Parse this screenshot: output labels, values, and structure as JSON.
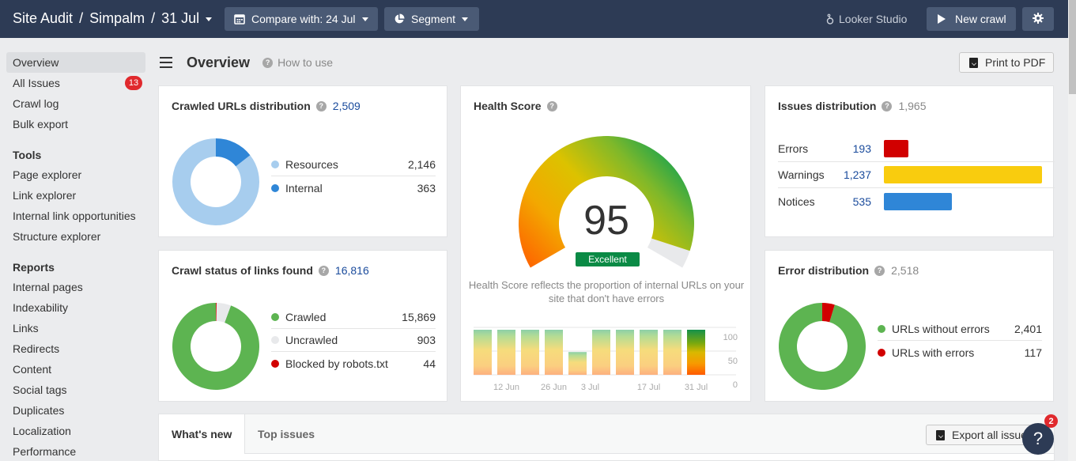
{
  "topbar": {
    "breadcrumb": [
      "Site Audit",
      "Simpalm",
      "31 Jul"
    ],
    "separator": "/",
    "compare_label": "Compare with: 24 Jul",
    "segment_label": "Segment",
    "looker_label": "Looker Studio",
    "new_crawl_label": "New crawl",
    "icons": {
      "compare": "calendar-icon",
      "segment": "pie-chart-icon",
      "looker": "looker-icon",
      "new_crawl": "play-icon",
      "settings": "gear-icon"
    }
  },
  "sidebar": {
    "items": [
      {
        "label": "Overview",
        "active": true
      },
      {
        "label": "All Issues",
        "badge": "13"
      },
      {
        "label": "Crawl log"
      },
      {
        "label": "Bulk export"
      }
    ],
    "tools_heading": "Tools",
    "tools": [
      "Page explorer",
      "Link explorer",
      "Internal link opportunities",
      "Structure explorer"
    ],
    "reports_heading": "Reports",
    "reports": [
      "Internal pages",
      "Indexability",
      "Links",
      "Redirects",
      "Content",
      "Social tags",
      "Duplicates",
      "Localization",
      "Performance"
    ]
  },
  "page": {
    "title": "Overview",
    "how_to_use": "How to use",
    "print_label": "Print to PDF",
    "help_icon": "?",
    "info_icon": "?"
  },
  "crawled_urls": {
    "title": "Crawled URLs distribution",
    "total": "2,509",
    "items": [
      {
        "label": "Resources",
        "value": "2,146",
        "raw": 2146,
        "color": "#a7cdee"
      },
      {
        "label": "Internal",
        "value": "363",
        "raw": 363,
        "color": "#2f86d7"
      }
    ]
  },
  "crawl_status": {
    "title": "Crawl status of links found",
    "total": "16,816",
    "items": [
      {
        "label": "Crawled",
        "value": "15,869",
        "raw": 15869,
        "color": "#5db451"
      },
      {
        "label": "Uncrawled",
        "value": "903",
        "raw": 903,
        "color": "#e8e9eb"
      },
      {
        "label": "Blocked by robots.txt",
        "value": "44",
        "raw": 44,
        "color": "#d10000"
      }
    ]
  },
  "health": {
    "title": "Health Score",
    "score": "95",
    "score_value": 95,
    "rating": "Excellent",
    "description": "Health Score reflects the proportion of internal URLs on your site that don't have errors",
    "history": {
      "y_ticks": [
        "100",
        "50",
        "0"
      ],
      "x_labels": [
        "12 Jun",
        "26 Jun",
        "3 Jul",
        "17 Jul",
        "31 Jul"
      ],
      "values": [
        95,
        95,
        95,
        95,
        48,
        95,
        95,
        95,
        95,
        95
      ]
    }
  },
  "issues": {
    "title": "Issues distribution",
    "total": "1,965",
    "items": [
      {
        "label": "Errors",
        "value": "193",
        "raw": 193,
        "color": "#d10000"
      },
      {
        "label": "Warnings",
        "value": "1,237",
        "raw": 1237,
        "color": "#f9cc0e"
      },
      {
        "label": "Notices",
        "value": "535",
        "raw": 535,
        "color": "#2f86d7"
      }
    ]
  },
  "errors": {
    "title": "Error distribution",
    "total": "2,518",
    "items": [
      {
        "label": "URLs without errors",
        "value": "2,401",
        "raw": 2401,
        "color": "#5db451"
      },
      {
        "label": "URLs with errors",
        "value": "117",
        "raw": 117,
        "color": "#d10000"
      }
    ]
  },
  "bottom": {
    "tabs": [
      {
        "label": "What's new",
        "active": true
      },
      {
        "label": "Top issues"
      }
    ],
    "export_label": "Export all issues",
    "help_badge": "2",
    "help_label": "?"
  }
}
